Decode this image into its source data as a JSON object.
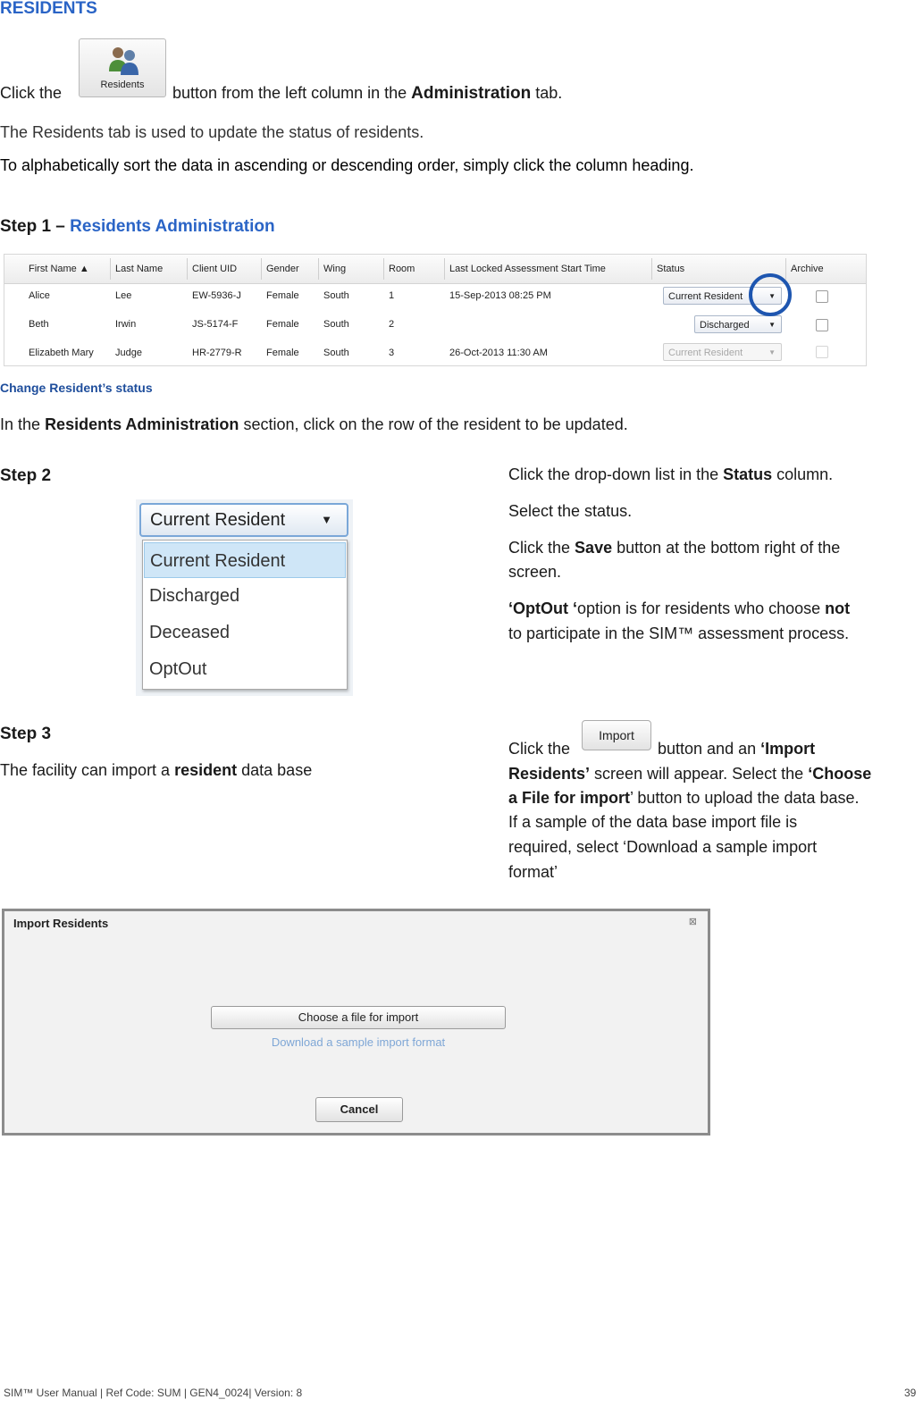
{
  "section_title": "RESIDENTS",
  "intro": {
    "click_the": "Click the",
    "residents_button_label": "Residents",
    "button_from": "button from the left column in the",
    "administration": "Administration",
    "tab": "tab.",
    "line2": "The Residents tab is used to update the status of residents.",
    "line3": "To alphabetically sort the data in ascending or descending order, simply click the column heading."
  },
  "step1": {
    "prefix": "Step 1 –",
    "title": "Residents Administration"
  },
  "table": {
    "headers": [
      "First Name ▲",
      "Last Name",
      "Client UID",
      "Gender",
      "Wing",
      "Room",
      "Last Locked Assessment Start Time",
      "Status",
      "Archive"
    ],
    "rows": [
      {
        "first": "Alice",
        "last": "Lee",
        "uid": "EW-5936-J",
        "gender": "Female",
        "wing": "South",
        "room": "1",
        "time": "15-Sep-2013 08:25 PM",
        "status": "Current Resident"
      },
      {
        "first": "Beth",
        "last": "Irwin",
        "uid": "JS-5174-F",
        "gender": "Female",
        "wing": "South",
        "room": "2",
        "time": "",
        "status": "Discharged"
      },
      {
        "first": "Elizabeth Mary",
        "last": "Judge",
        "uid": "HR-2779-R",
        "gender": "Female",
        "wing": "South",
        "room": "3",
        "time": "26-Oct-2013 11:30 AM",
        "status": "Current Resident"
      }
    ]
  },
  "caption": "Change Resident’s status",
  "change_text": {
    "in_the": "In the",
    "section": "Residents Administration",
    "rest": "section, click on the row of the resident to be updated."
  },
  "step2": {
    "title": "Step 2",
    "dropdown_selected": "Current Resident",
    "options": [
      "Current Resident",
      "Discharged",
      "Deceased",
      "OptOut"
    ],
    "l1a": "Click the drop-down list in the",
    "l1b": "Status",
    "l1c": "column.",
    "l2": "Select the status.",
    "l3a": "Click the",
    "l3b": "Save",
    "l3c": "button at the bottom right of the",
    "l3d": "screen.",
    "l4a": "‘OptOut ‘",
    "l4b": "option is for residents who choose",
    "l4c": "not",
    "l4d": "to participate in the SIM™ assessment process."
  },
  "step3": {
    "title": "Step 3",
    "left_a": "The facility can import a",
    "left_b": "resident",
    "left_c": "data base",
    "click_the": "Click the",
    "import_label": "Import",
    "r1a": "button and an",
    "r1b": "‘Import",
    "r2a": "Residents’",
    "r2b": "screen will appear. Select the",
    "r2c": "‘Choose",
    "r3a": "a File for import",
    "r3b": "’ button to upload the data base.",
    "r4": "If a sample of the data base import file is",
    "r5": "required, select ‘Download a sample import",
    "r6": "format’"
  },
  "dialog": {
    "title": "Import Residents",
    "choose": "Choose a file for import",
    "sample": "Download a sample import format",
    "cancel": "Cancel"
  },
  "footer": {
    "left": "SIM™ User Manual | Ref Code: SUM | GEN4_0024| Version: 8",
    "page": "39"
  },
  "colors": {
    "heading_blue": "#2a64c6",
    "caption_blue": "#1f4e9c",
    "circle": "#1e56b0"
  }
}
